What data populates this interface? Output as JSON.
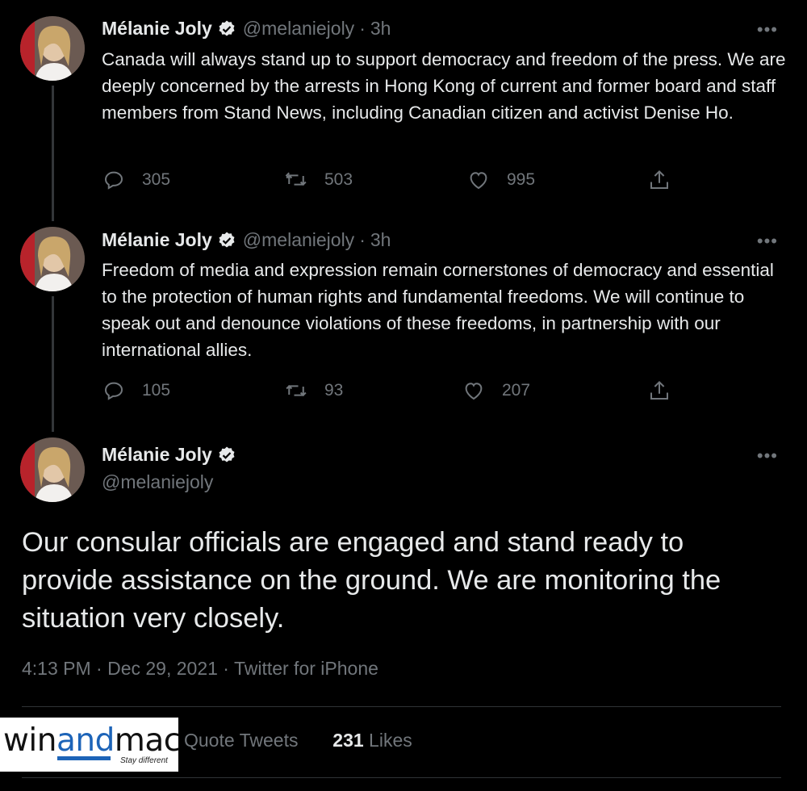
{
  "tweets": [
    {
      "name": "Mélanie Joly",
      "handle": "@melaniejoly",
      "time": "3h",
      "more": "•••",
      "text": "Canada will always stand up to support democracy and freedom of the press. We are deeply concerned by the arrests in Hong Kong of current and former board and staff members from Stand News, including Canadian citizen and activist Denise Ho.",
      "replies": "305",
      "retweets": "503",
      "likes": "995"
    },
    {
      "name": "Mélanie Joly",
      "handle": "@melaniejoly",
      "time": "3h",
      "more": "•••",
      "text": "Freedom of media and expression remain cornerstones of democracy and essential to the protection of human rights and fundamental freedoms. We will continue to speak out and denounce violations of these freedoms, in partnership with our international allies.",
      "replies": "105",
      "retweets": "93",
      "likes": "207"
    }
  ],
  "main_tweet": {
    "name": "Mélanie Joly",
    "handle": "@melaniejoly",
    "more": "•••",
    "text": "Our consular officials are engaged and stand ready to provide assistance on the ground. We are monitoring the situation very closely.",
    "meta": "4:13 PM · Dec 29, 2021 · Twitter for iPhone",
    "quote_tweets_label": "Quote Tweets",
    "likes_count": "231",
    "likes_label": "Likes"
  },
  "watermark": {
    "part1": "win",
    "part2": "and",
    "part3": "mac",
    "tagline": "Stay different"
  },
  "colors": {
    "background": "#000000",
    "text": "#e7e9ea",
    "muted": "#71767b",
    "watermark_blue": "#1d64b8"
  },
  "icons": [
    "verified-badge-icon",
    "reply-icon",
    "retweet-icon",
    "like-icon",
    "share-icon",
    "more-icon"
  ]
}
